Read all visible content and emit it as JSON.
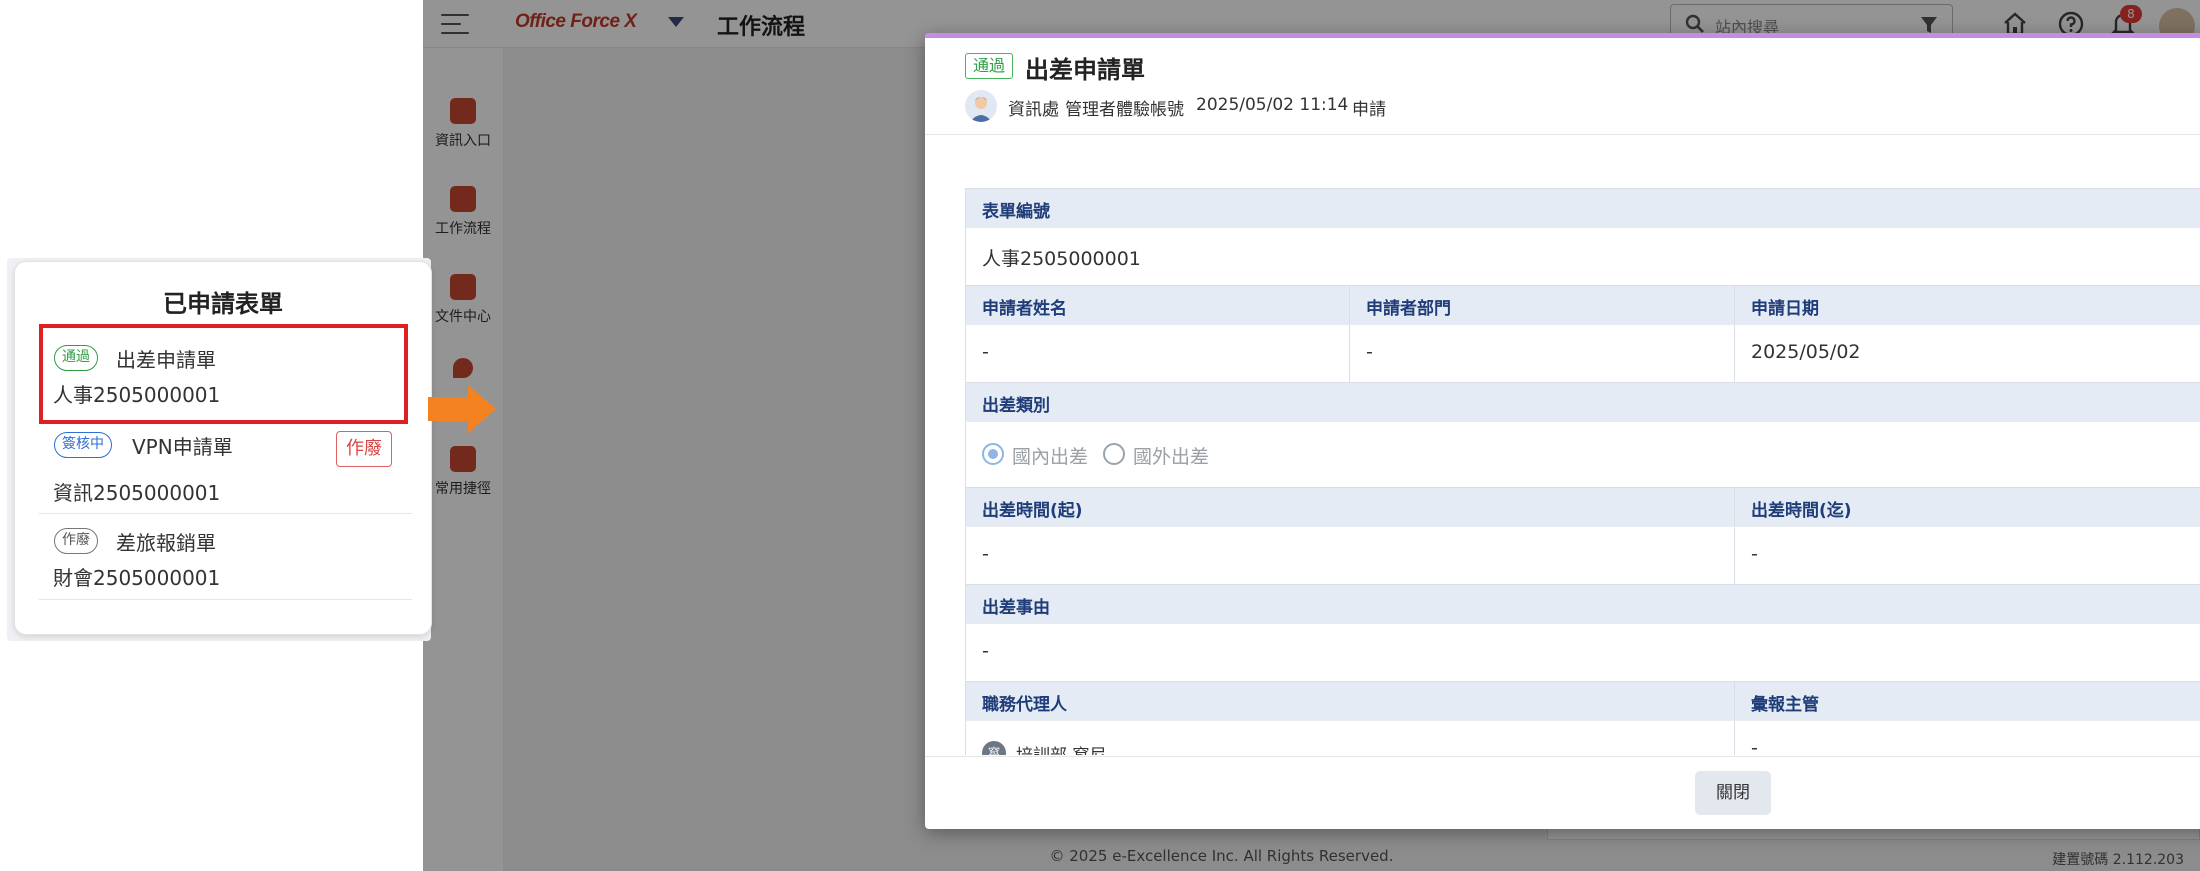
{
  "app": {
    "brand": "Office Force X",
    "page_title": "工作流程",
    "search_placeholder": "站內搜尋",
    "notification_count": "8",
    "nav": [
      "資訊入口",
      "工作流程",
      "文件中心",
      "",
      "常用捷徑"
    ],
    "footer": "© 2025 e-Excellence Inc. All Rights Reserved.",
    "build": "建置號碼 2.112.203"
  },
  "modal": {
    "status": "通過",
    "title": "出差申請單",
    "dept": "資訊處",
    "applicant": "管理者體驗帳號",
    "datetime": "2025/05/02 11:14",
    "action": "申請",
    "close_label": "關閉",
    "fields": {
      "form_no_label": "表單編號",
      "form_no": "人事2505000001",
      "name_label": "申請者姓名",
      "name": "-",
      "dept_label": "申請者部門",
      "dept": "-",
      "date_label": "申請日期",
      "date": "2025/05/02",
      "type_label": "出差類別",
      "type_options": [
        "國內出差",
        "國外出差"
      ],
      "type_selected": "國內出差",
      "start_label": "出差時間(起)",
      "start": "-",
      "end_label": "出差時間(迄)",
      "end": "-",
      "reason_label": "出差事由",
      "reason": "-",
      "agent_label": "職務代理人",
      "agent_avatar": "窩",
      "agent": "培訓部 窩尼",
      "supervisor_label": "彙報主管",
      "supervisor": "-"
    }
  },
  "callout": {
    "title": "已申請表單",
    "items": [
      {
        "status": "通過",
        "form": "出差申請單",
        "code": "人事2505000001",
        "status_color": "#2e9f45"
      },
      {
        "status": "簽核中",
        "form": "VPN申請單",
        "code": "資訊2505000001",
        "status_color": "#2f6fd6",
        "action": "作廢"
      },
      {
        "status": "作廢",
        "form": "差旅報銷單",
        "code": "財會2505000001",
        "status_color": "#666666"
      }
    ]
  },
  "colors": {
    "accent": "#c58be6",
    "label_bg": "#e4ebf5",
    "label_text": "#1f3d78",
    "highlight": "#e02020",
    "arrow": "#f58220"
  }
}
